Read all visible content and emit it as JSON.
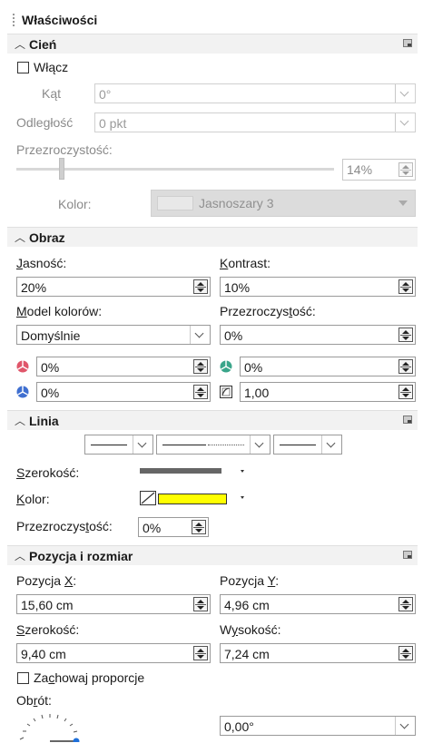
{
  "panel": {
    "title": "Właściwości"
  },
  "shadow": {
    "section_label": "Cień",
    "enable_label": "Włącz",
    "angle_label": "Kąt",
    "angle_value": "0°",
    "distance_label": "Odległość",
    "distance_value": "0 pkt",
    "transparency_label": "Przezroczystość:",
    "transparency_value": "14%",
    "color_label": "Kolor:",
    "color_value": "Jasnoszary 3"
  },
  "image": {
    "section_label": "Obraz",
    "brightness_label": "Jasność:",
    "brightness_value": "20%",
    "contrast_label": "Kontrast:",
    "contrast_value": "10%",
    "color_mode_label": "Model kolorów:",
    "color_mode_value": "Domyślnie",
    "transparency_label": "Przezroczystość:",
    "transparency_value": "0%",
    "red_value": "0%",
    "green_value": "0%",
    "blue_value": "0%",
    "gamma_value": "1,00",
    "colors": {
      "red": "#e0566a",
      "green": "#3aa58a",
      "blue": "#3f6fd0"
    }
  },
  "line": {
    "section_label": "Linia",
    "width_label": "Szerokość:",
    "color_label": "Kolor:",
    "color_swatch": "#ffff00",
    "transparency_label": "Przezroczystość:",
    "transparency_value": "0%"
  },
  "position": {
    "section_label": "Pozycja i rozmiar",
    "pos_x_label": "Pozycja X:",
    "pos_x_value": "15,60 cm",
    "pos_y_label": "Pozycja Y:",
    "pos_y_value": "4,96 cm",
    "width_label": "Szerokość:",
    "width_value": "9,40 cm",
    "height_label": "Wysokość:",
    "height_value": "7,24 cm",
    "keep_ratio_label": "Zachowaj proporcje",
    "rotation_label": "Obrót:",
    "rotation_value": "0,00°"
  }
}
